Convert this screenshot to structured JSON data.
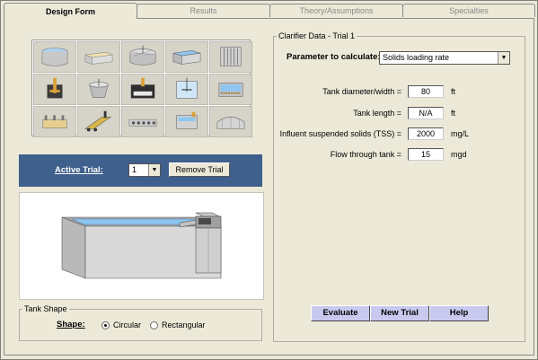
{
  "tabs": [
    {
      "label": "Design Form",
      "active": true
    },
    {
      "label": "Results",
      "active": false
    },
    {
      "label": "Theory/Assumptions",
      "active": false
    },
    {
      "label": "Specialties",
      "active": false
    }
  ],
  "icons": [
    "circular-clarifier-icon",
    "rectangular-basin-icon",
    "dome-clarifier-icon",
    "rectangular-tank-icon",
    "plate-settler-icon",
    "mixer-tank-icon",
    "sludge-blanket-icon",
    "aeration-tank-icon",
    "flocculator-icon",
    "filter-bed-icon",
    "channel-basin-icon",
    "conveyor-icon",
    "diffuser-grid-icon",
    "sedimentation-tank-icon",
    "covered-tank-icon"
  ],
  "trial": {
    "label": "Active Trial:",
    "selected": "1",
    "remove_label": "Remove Trial"
  },
  "tank_shape": {
    "group_title": "Tank Shape",
    "shape_label": "Shape:",
    "options": [
      {
        "label": "Circular",
        "selected": true
      },
      {
        "label": "Rectangular",
        "selected": false
      }
    ]
  },
  "clarifier": {
    "group_title": "Clarifier Data - Trial 1",
    "param_label": "Parameter to calculate:",
    "param_value": "Solids loading rate",
    "fields": [
      {
        "label": "Tank diameter/width =",
        "value": "80",
        "unit": "ft"
      },
      {
        "label": "Tank length =",
        "value": "N/A",
        "unit": "ft"
      },
      {
        "label": "Influent suspended solids (TSS) =",
        "value": "2000",
        "unit": "mg/L"
      },
      {
        "label": "Flow through tank =",
        "value": "15",
        "unit": "mgd"
      }
    ]
  },
  "actions": {
    "evaluate": "Evaluate",
    "new_trial": "New Trial",
    "help": "Help"
  },
  "colors": {
    "trial_bar": "#3f5f8c",
    "action_button": "#c9c9f0",
    "water": "#8ec6f2"
  }
}
